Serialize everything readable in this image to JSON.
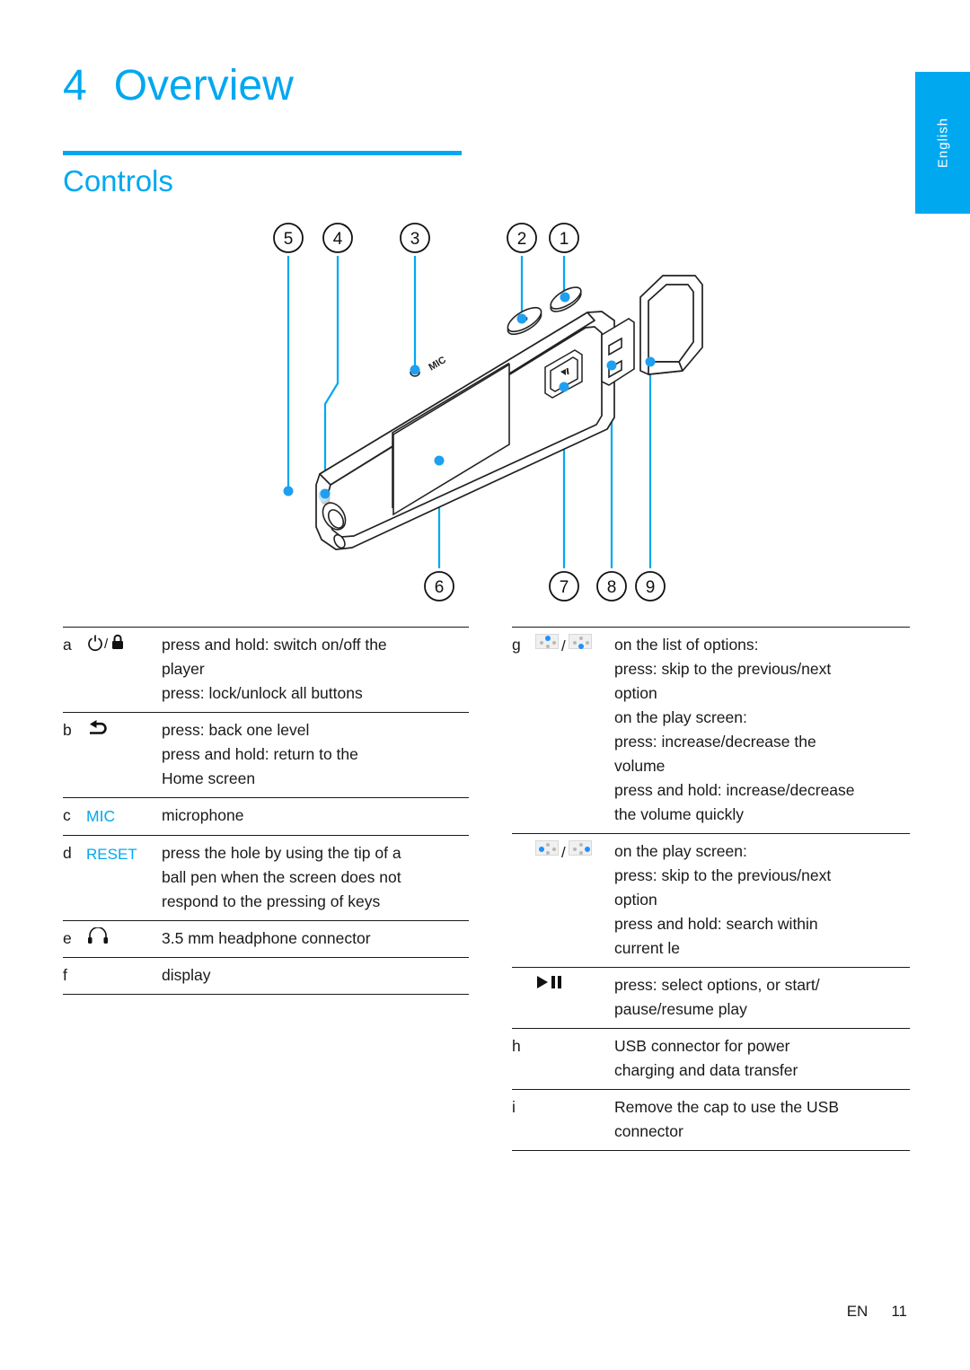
{
  "language_tab": {
    "label": "English"
  },
  "heading": {
    "chapter_number": "4",
    "chapter_title": "Overview",
    "section_title": "Controls"
  },
  "diagram": {
    "name": "mp3-player-controls-illustration",
    "callouts_top": [
      "5",
      "4",
      "3",
      "2",
      "1"
    ],
    "callouts_bottom": [
      "6",
      "7",
      "8",
      "9"
    ],
    "device_labels": {
      "mic": "MIC"
    }
  },
  "table_left": {
    "rows": [
      {
        "key": "a",
        "icon": "power-lock-icon",
        "lines": [
          "press and hold: switch on/off the",
          "player",
          "press: lock/unlock all buttons"
        ]
      },
      {
        "key": "b",
        "icon": "back-arrow-icon",
        "lines": [
          "press: back one level",
          "press and hold: return to the",
          "Home screen"
        ]
      },
      {
        "key": "c",
        "icon_label": "MIC",
        "lines": [
          "microphone"
        ]
      },
      {
        "key": "d",
        "icon_label": "RESET",
        "lines": [
          "press the hole by using the tip of a",
          "ball pen when the screen does not",
          "respond to the pressing of keys"
        ]
      },
      {
        "key": "e",
        "icon": "headphone-icon",
        "lines": [
          "3.5 mm headphone connector"
        ]
      },
      {
        "key": "f",
        "icon": "",
        "lines": [
          "display"
        ]
      }
    ]
  },
  "table_right": {
    "rows": [
      {
        "key": "g",
        "icon": "navpad-up-down-icon",
        "separator": "/",
        "lines": [
          "on the list of options:",
          "press: skip to the previous/next",
          "option",
          "on the play screen:",
          "press: increase/decrease the",
          "volume",
          "press and hold: increase/decrease",
          "the volume quickly"
        ]
      },
      {
        "key": "",
        "icon": "navpad-left-right-icon",
        "separator": "/",
        "lines": [
          "on the play screen:",
          "press: skip to the previous/next",
          "option",
          "press and hold: search within",
          "current  le"
        ]
      },
      {
        "key": "",
        "icon": "play-pause-icon",
        "lines": [
          "press: select options, or start/",
          "pause/resume play"
        ]
      },
      {
        "key": "h",
        "icon": "",
        "lines": [
          "USB connector for power",
          "charging and data transfer"
        ]
      },
      {
        "key": "i",
        "icon": "",
        "lines": [
          "Remove the cap to use the USB",
          "connector"
        ]
      }
    ]
  },
  "footer": {
    "locale": "EN",
    "page_number": "11"
  },
  "colors": {
    "accent": "#00a8f0",
    "text": "#1a1a1a",
    "dot": "#1e90ff"
  }
}
